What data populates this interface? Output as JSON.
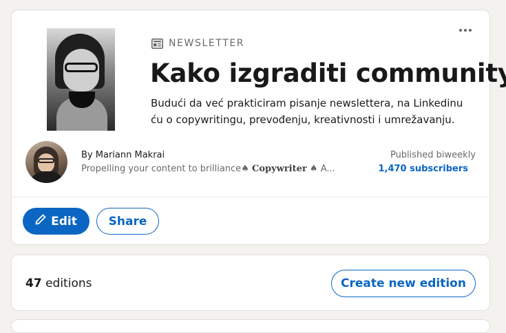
{
  "newsletter": {
    "kicker": "NEWSLETTER",
    "kicker_icon": "newspaper-icon",
    "title": "Kako izgraditi community",
    "description": "Budući da već prakticiram pisanje newslettera, na Linkedinu ću o copywritingu, prevođenju, kreativnosti i umrežavanju.",
    "more_icon": "more-options-icon"
  },
  "author": {
    "by_label": "By",
    "name": "Mariann Makrai",
    "tagline_prefix": "Propelling your content to brilliance",
    "tagline_spade1": "♠",
    "tagline_bold": "Copywriter",
    "tagline_spade2": "♠",
    "tagline_suffix": "A..."
  },
  "stats": {
    "frequency": "Published biweekly",
    "subscribers": "1,470 subscribers"
  },
  "actions": {
    "edit_label": "Edit",
    "edit_icon": "pencil-icon",
    "share_label": "Share"
  },
  "editions": {
    "count": "47",
    "count_label": "editions",
    "create_label": "Create new edition"
  },
  "colors": {
    "accent": "#0a66c2",
    "background": "#f4f2ee",
    "card": "#ffffff"
  }
}
